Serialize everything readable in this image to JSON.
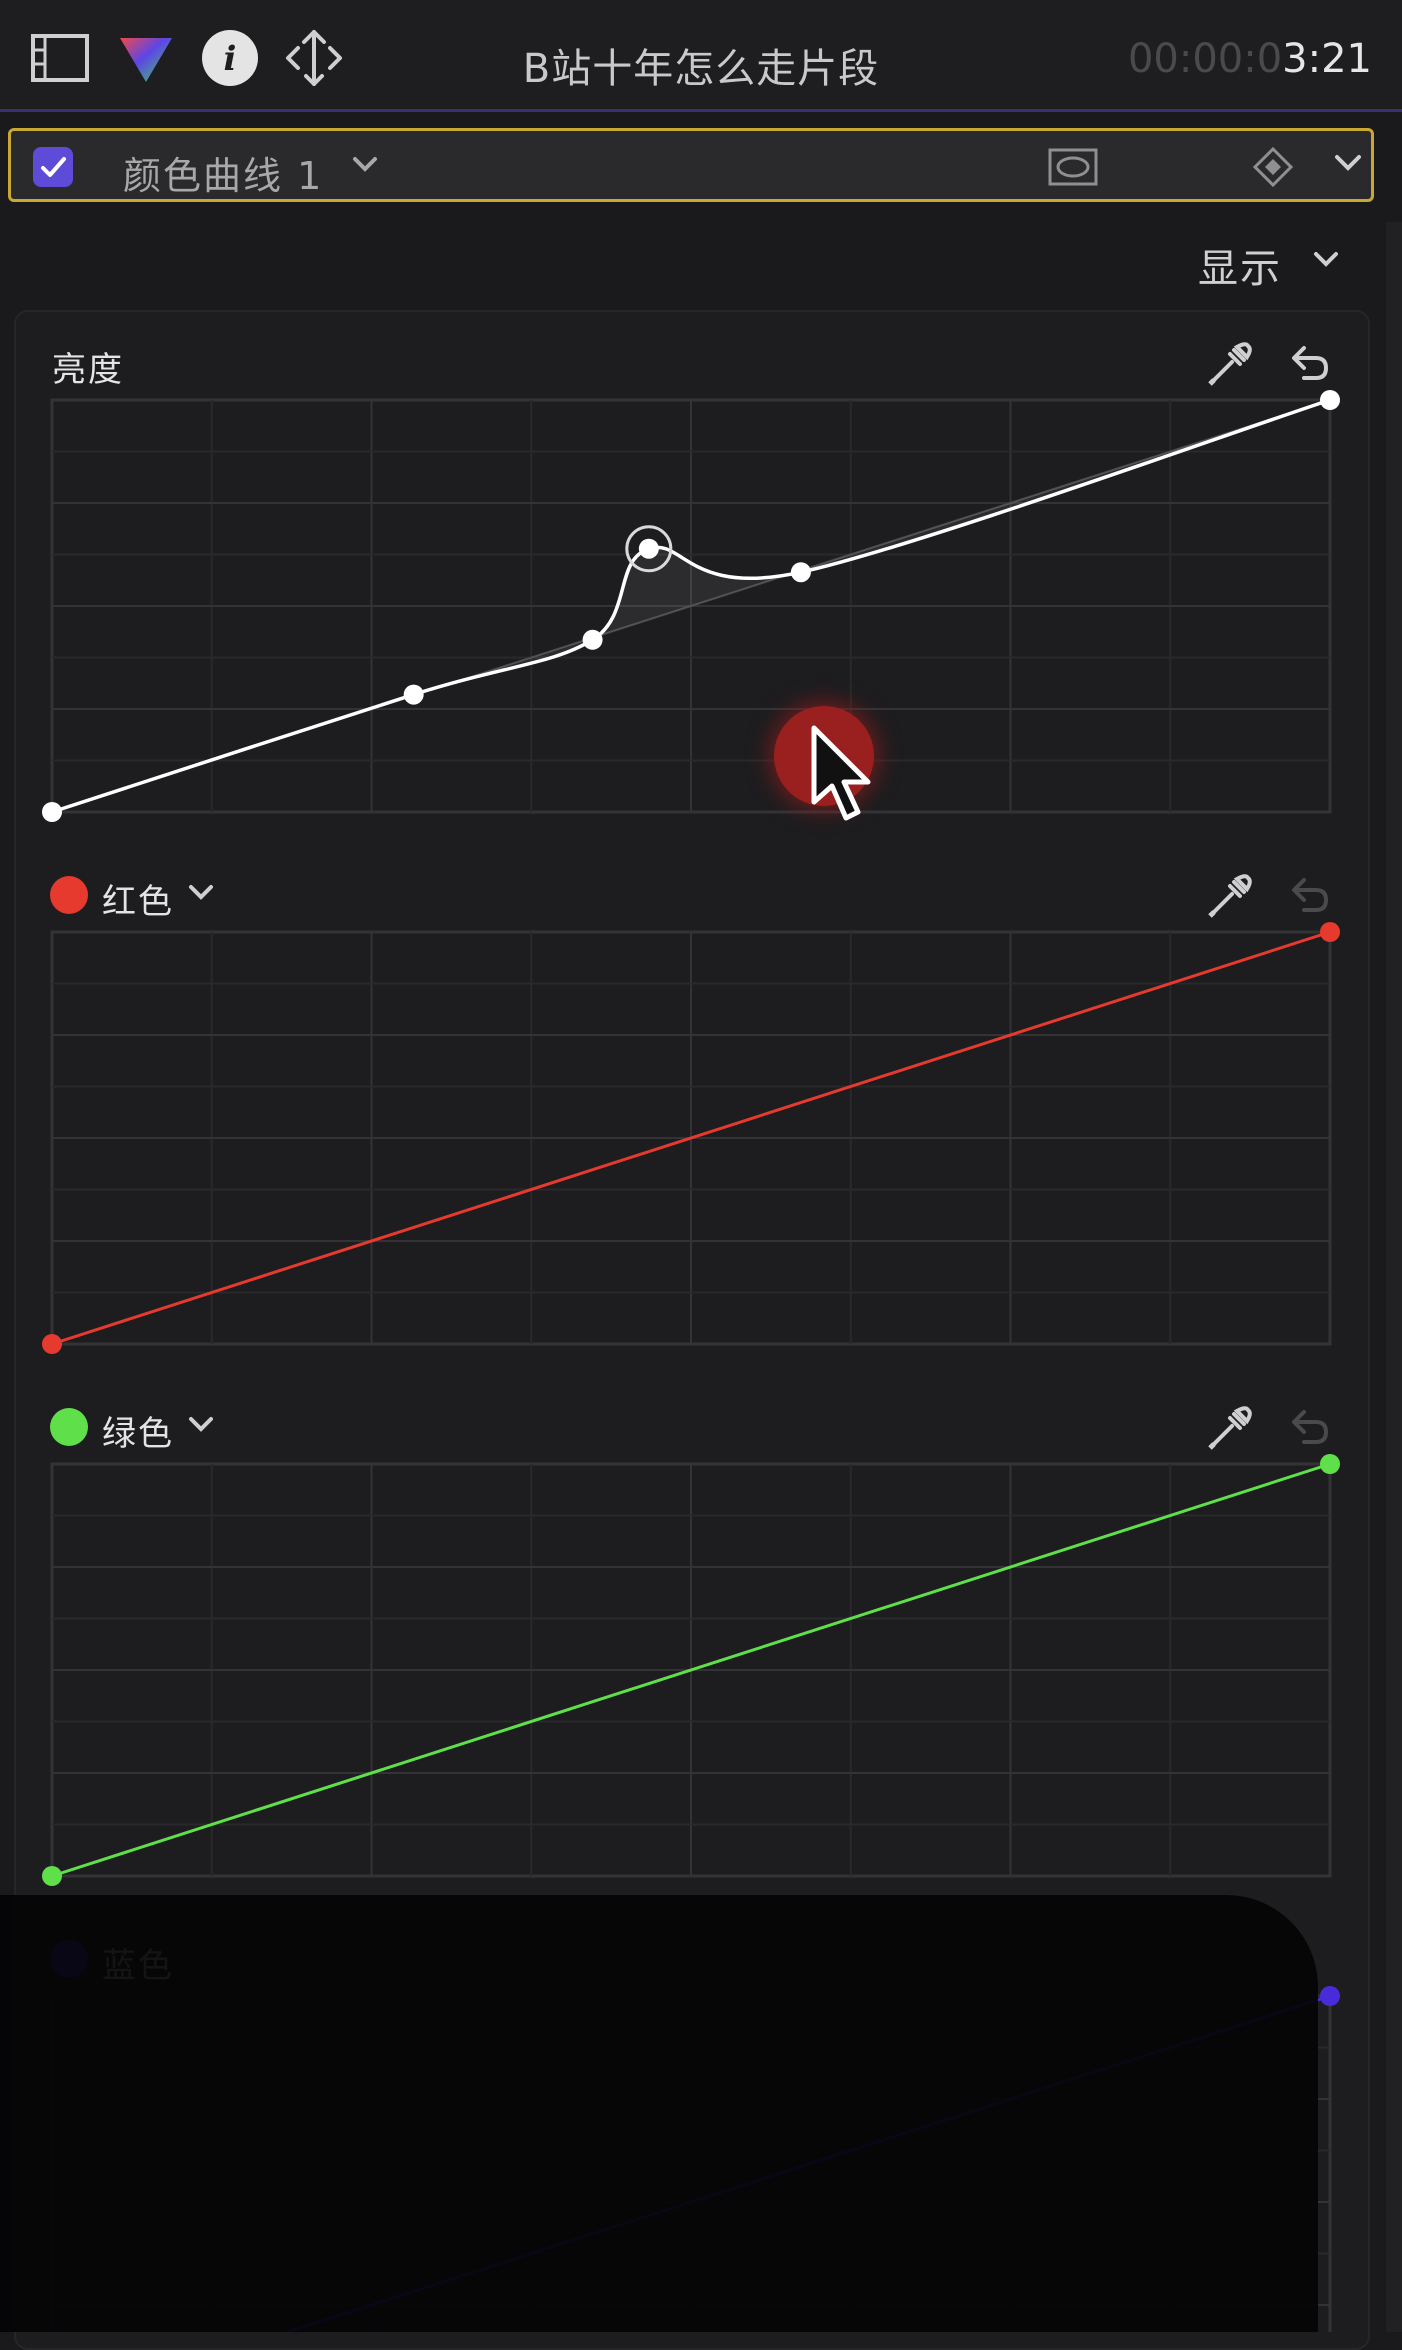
{
  "toolbar": {
    "title": "B站十年怎么走片段",
    "timecode_dim": "00:00:0",
    "timecode_bright": "3:21",
    "icons": [
      "film-inspector-icon",
      "color-inspector-icon",
      "info-icon",
      "transform-icon"
    ]
  },
  "effect": {
    "name": "颜色曲线 1",
    "enabled": true,
    "accent": "#c8a832",
    "checkbox_color": "#5e4bd8"
  },
  "display_menu": {
    "label": "显示"
  },
  "curves": [
    {
      "label": "亮度",
      "color": "#ffffff",
      "points": [
        [
          0,
          0
        ],
        [
          0.283,
          0.285
        ],
        [
          0.423,
          0.418
        ],
        [
          0.467,
          0.639
        ],
        [
          0.586,
          0.582
        ],
        [
          1,
          1
        ]
      ]
    },
    {
      "label": "红色",
      "color": "#e53a2d",
      "points": [
        [
          0,
          0
        ],
        [
          1,
          1
        ]
      ]
    },
    {
      "label": "绿色",
      "color": "#5fe04a",
      "points": [
        [
          0,
          0
        ],
        [
          1,
          1
        ]
      ]
    },
    {
      "label": "蓝色",
      "color": "#4a2bd9",
      "points": [
        [
          0,
          0
        ],
        [
          1,
          1
        ]
      ]
    }
  ]
}
